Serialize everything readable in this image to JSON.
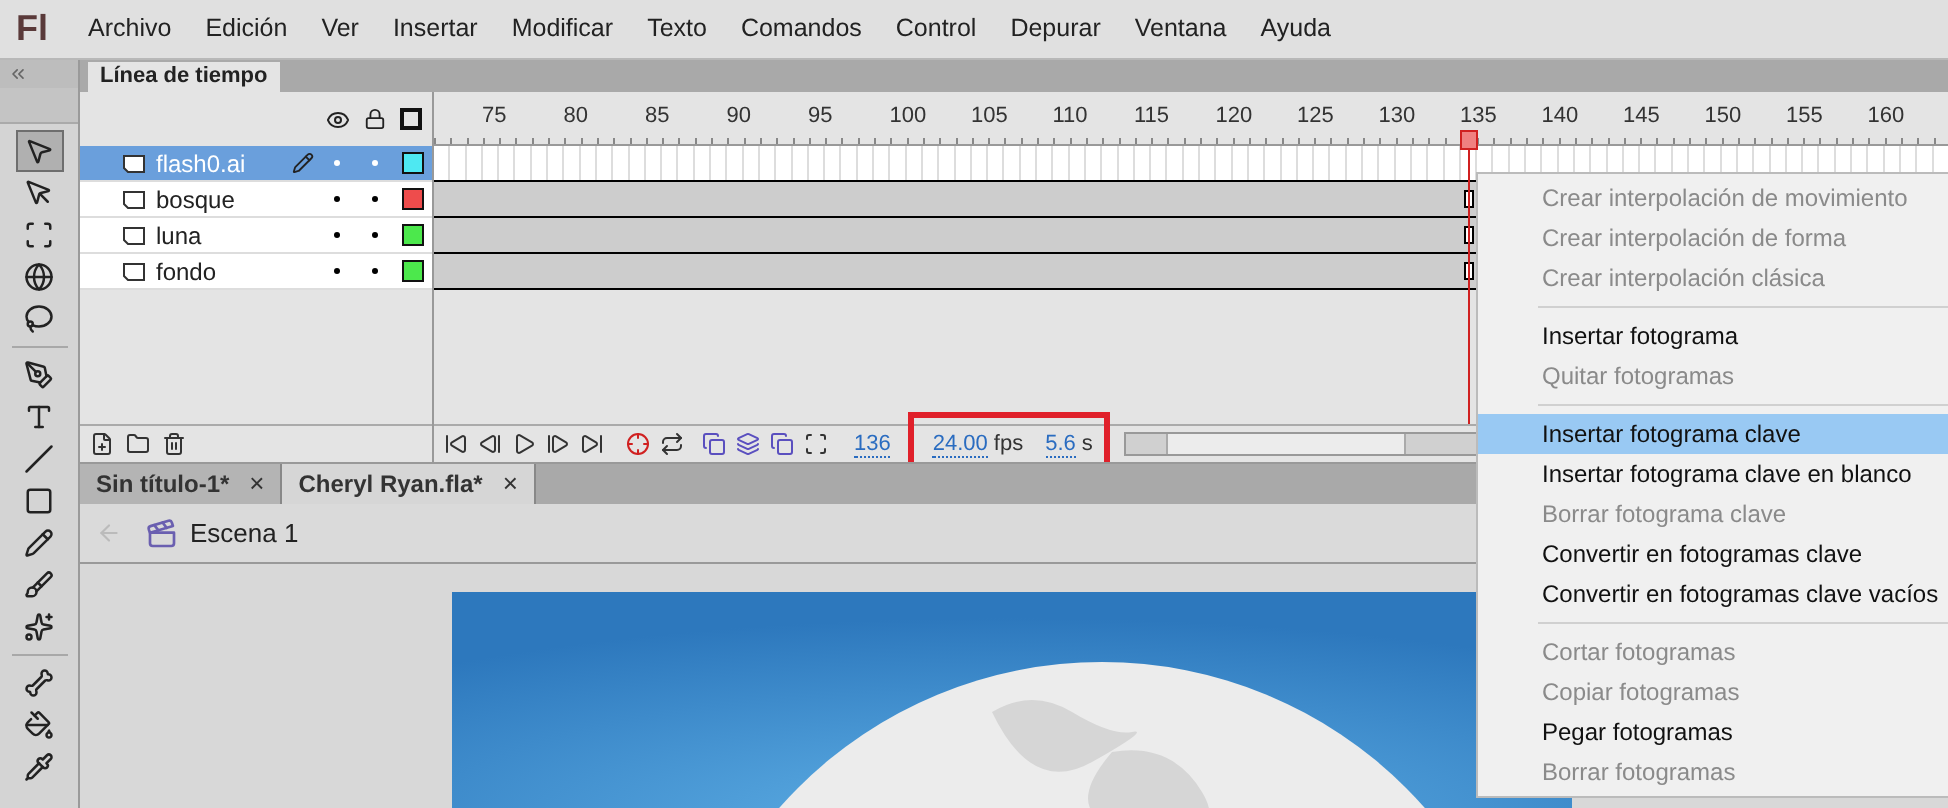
{
  "app": {
    "logo": "Fl"
  },
  "menu_bar": [
    "Archivo",
    "Edición",
    "Ver",
    "Insertar",
    "Modificar",
    "Texto",
    "Comandos",
    "Control",
    "Depurar",
    "Ventana",
    "Ayuda"
  ],
  "tools": [
    {
      "selected": true
    },
    {
      "selected": false
    },
    {
      "selected": false
    },
    {
      "selected": false
    },
    {
      "selected": false
    },
    {
      "selected": false
    },
    {
      "selected": false
    },
    {
      "selected": false
    },
    {
      "selected": false
    },
    {
      "selected": false
    },
    {
      "selected": false
    },
    {
      "selected": false
    },
    {
      "selected": false
    },
    {
      "selected": false
    },
    {
      "selected": false
    }
  ],
  "timeline": {
    "tab": "Línea de tiempo",
    "ruler": [
      "75",
      "80",
      "85",
      "90",
      "95",
      "100",
      "105",
      "110",
      "115",
      "120",
      "125",
      "130",
      "135",
      "140",
      "145",
      "150",
      "155",
      "160"
    ],
    "layers": [
      {
        "name": "flash0.ai",
        "selected": true,
        "color": "#4ee8f2"
      },
      {
        "name": "bosque",
        "selected": false,
        "color": "#ee4c4c"
      },
      {
        "name": "luna",
        "selected": false,
        "color": "#4ce84c"
      },
      {
        "name": "fondo",
        "selected": false,
        "color": "#4ce84c"
      }
    ],
    "current_frame": "136",
    "frame_rate": "24.00",
    "frame_rate_unit": "fps",
    "elapsed": "5.6",
    "elapsed_unit": "s"
  },
  "document_tabs": [
    {
      "label": "Sin título-1*",
      "selected": false,
      "close": "×"
    },
    {
      "label": "Cheryl Ryan.fla*",
      "selected": true,
      "close": "×"
    }
  ],
  "breadcrumb": {
    "scene": "Escena 1"
  },
  "context_menu": [
    {
      "kind": "item",
      "label": "Crear interpolación de movimiento",
      "disabled": true,
      "selected": false
    },
    {
      "kind": "item",
      "label": "Crear interpolación de forma",
      "disabled": true,
      "selected": false
    },
    {
      "kind": "item",
      "label": "Crear interpolación clásica",
      "disabled": true,
      "selected": false
    },
    {
      "kind": "separator"
    },
    {
      "kind": "item",
      "label": "Insertar fotograma",
      "disabled": false,
      "selected": false
    },
    {
      "kind": "item",
      "label": "Quitar fotogramas",
      "disabled": true,
      "selected": false
    },
    {
      "kind": "separator"
    },
    {
      "kind": "item",
      "label": "Insertar fotograma clave",
      "disabled": false,
      "selected": true
    },
    {
      "kind": "item",
      "label": "Insertar fotograma clave en blanco",
      "disabled": false,
      "selected": false
    },
    {
      "kind": "item",
      "label": "Borrar fotograma clave",
      "disabled": true,
      "selected": false
    },
    {
      "kind": "item",
      "label": "Convertir en fotogramas clave",
      "disabled": false,
      "selected": false
    },
    {
      "kind": "item",
      "label": "Convertir en fotogramas clave vacíos",
      "disabled": false,
      "selected": false
    },
    {
      "kind": "separator"
    },
    {
      "kind": "item",
      "label": "Cortar fotogramas",
      "disabled": true,
      "selected": false
    },
    {
      "kind": "item",
      "label": "Copiar fotogramas",
      "disabled": true,
      "selected": false
    },
    {
      "kind": "item",
      "label": "Pegar fotogramas",
      "disabled": false,
      "selected": false
    },
    {
      "kind": "item",
      "label": "Borrar fotogramas",
      "disabled": true,
      "selected": false
    }
  ]
}
